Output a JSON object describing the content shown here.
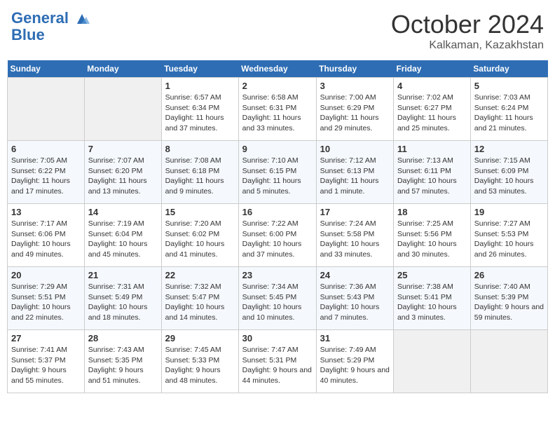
{
  "header": {
    "logo_line1": "General",
    "logo_line2": "Blue",
    "month": "October 2024",
    "location": "Kalkaman, Kazakhstan"
  },
  "weekdays": [
    "Sunday",
    "Monday",
    "Tuesday",
    "Wednesday",
    "Thursday",
    "Friday",
    "Saturday"
  ],
  "weeks": [
    [
      {
        "day": "",
        "info": ""
      },
      {
        "day": "",
        "info": ""
      },
      {
        "day": "1",
        "info": "Sunrise: 6:57 AM\nSunset: 6:34 PM\nDaylight: 11 hours and 37 minutes."
      },
      {
        "day": "2",
        "info": "Sunrise: 6:58 AM\nSunset: 6:31 PM\nDaylight: 11 hours and 33 minutes."
      },
      {
        "day": "3",
        "info": "Sunrise: 7:00 AM\nSunset: 6:29 PM\nDaylight: 11 hours and 29 minutes."
      },
      {
        "day": "4",
        "info": "Sunrise: 7:02 AM\nSunset: 6:27 PM\nDaylight: 11 hours and 25 minutes."
      },
      {
        "day": "5",
        "info": "Sunrise: 7:03 AM\nSunset: 6:24 PM\nDaylight: 11 hours and 21 minutes."
      }
    ],
    [
      {
        "day": "6",
        "info": "Sunrise: 7:05 AM\nSunset: 6:22 PM\nDaylight: 11 hours and 17 minutes."
      },
      {
        "day": "7",
        "info": "Sunrise: 7:07 AM\nSunset: 6:20 PM\nDaylight: 11 hours and 13 minutes."
      },
      {
        "day": "8",
        "info": "Sunrise: 7:08 AM\nSunset: 6:18 PM\nDaylight: 11 hours and 9 minutes."
      },
      {
        "day": "9",
        "info": "Sunrise: 7:10 AM\nSunset: 6:15 PM\nDaylight: 11 hours and 5 minutes."
      },
      {
        "day": "10",
        "info": "Sunrise: 7:12 AM\nSunset: 6:13 PM\nDaylight: 11 hours and 1 minute."
      },
      {
        "day": "11",
        "info": "Sunrise: 7:13 AM\nSunset: 6:11 PM\nDaylight: 10 hours and 57 minutes."
      },
      {
        "day": "12",
        "info": "Sunrise: 7:15 AM\nSunset: 6:09 PM\nDaylight: 10 hours and 53 minutes."
      }
    ],
    [
      {
        "day": "13",
        "info": "Sunrise: 7:17 AM\nSunset: 6:06 PM\nDaylight: 10 hours and 49 minutes."
      },
      {
        "day": "14",
        "info": "Sunrise: 7:19 AM\nSunset: 6:04 PM\nDaylight: 10 hours and 45 minutes."
      },
      {
        "day": "15",
        "info": "Sunrise: 7:20 AM\nSunset: 6:02 PM\nDaylight: 10 hours and 41 minutes."
      },
      {
        "day": "16",
        "info": "Sunrise: 7:22 AM\nSunset: 6:00 PM\nDaylight: 10 hours and 37 minutes."
      },
      {
        "day": "17",
        "info": "Sunrise: 7:24 AM\nSunset: 5:58 PM\nDaylight: 10 hours and 33 minutes."
      },
      {
        "day": "18",
        "info": "Sunrise: 7:25 AM\nSunset: 5:56 PM\nDaylight: 10 hours and 30 minutes."
      },
      {
        "day": "19",
        "info": "Sunrise: 7:27 AM\nSunset: 5:53 PM\nDaylight: 10 hours and 26 minutes."
      }
    ],
    [
      {
        "day": "20",
        "info": "Sunrise: 7:29 AM\nSunset: 5:51 PM\nDaylight: 10 hours and 22 minutes."
      },
      {
        "day": "21",
        "info": "Sunrise: 7:31 AM\nSunset: 5:49 PM\nDaylight: 10 hours and 18 minutes."
      },
      {
        "day": "22",
        "info": "Sunrise: 7:32 AM\nSunset: 5:47 PM\nDaylight: 10 hours and 14 minutes."
      },
      {
        "day": "23",
        "info": "Sunrise: 7:34 AM\nSunset: 5:45 PM\nDaylight: 10 hours and 10 minutes."
      },
      {
        "day": "24",
        "info": "Sunrise: 7:36 AM\nSunset: 5:43 PM\nDaylight: 10 hours and 7 minutes."
      },
      {
        "day": "25",
        "info": "Sunrise: 7:38 AM\nSunset: 5:41 PM\nDaylight: 10 hours and 3 minutes."
      },
      {
        "day": "26",
        "info": "Sunrise: 7:40 AM\nSunset: 5:39 PM\nDaylight: 9 hours and 59 minutes."
      }
    ],
    [
      {
        "day": "27",
        "info": "Sunrise: 7:41 AM\nSunset: 5:37 PM\nDaylight: 9 hours and 55 minutes."
      },
      {
        "day": "28",
        "info": "Sunrise: 7:43 AM\nSunset: 5:35 PM\nDaylight: 9 hours and 51 minutes."
      },
      {
        "day": "29",
        "info": "Sunrise: 7:45 AM\nSunset: 5:33 PM\nDaylight: 9 hours and 48 minutes."
      },
      {
        "day": "30",
        "info": "Sunrise: 7:47 AM\nSunset: 5:31 PM\nDaylight: 9 hours and 44 minutes."
      },
      {
        "day": "31",
        "info": "Sunrise: 7:49 AM\nSunset: 5:29 PM\nDaylight: 9 hours and 40 minutes."
      },
      {
        "day": "",
        "info": ""
      },
      {
        "day": "",
        "info": ""
      }
    ]
  ]
}
